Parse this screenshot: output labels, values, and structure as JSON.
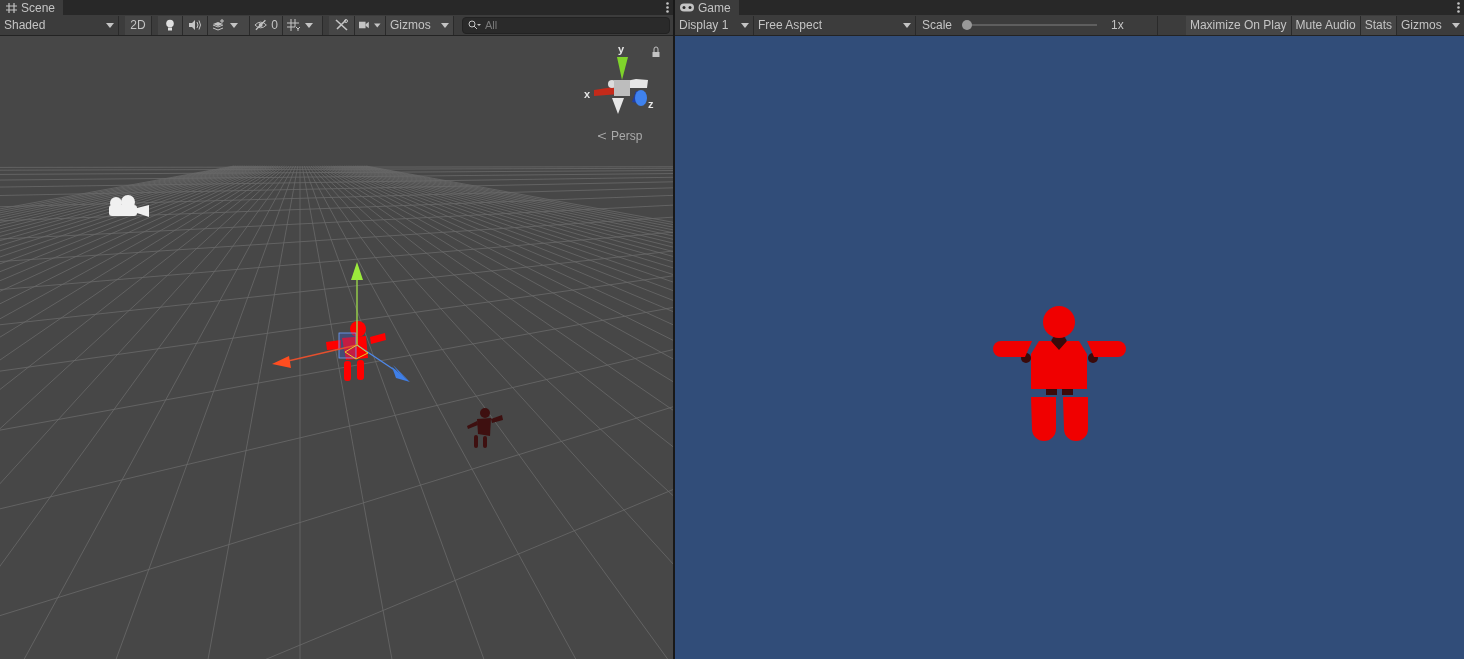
{
  "scene": {
    "tab": {
      "label": "Scene"
    },
    "toolbar": {
      "draw_mode": "Shaded",
      "mode_2d": "2D",
      "hidden_count": "0",
      "gizmos": "Gizmos",
      "search": {
        "placeholder": "All"
      }
    },
    "view": {
      "axis_labels": [
        "x",
        "y",
        "z"
      ],
      "projection": "Persp"
    }
  },
  "game": {
    "tab": {
      "label": "Game"
    },
    "toolbar": {
      "display": "Display 1",
      "aspect": "Free Aspect",
      "scale": {
        "label": "Scale",
        "level": 0,
        "reading": "1x"
      },
      "buttons": [
        "Maximize On Play",
        "Mute Audio",
        "Stats"
      ],
      "gizmos": "Gizmos"
    }
  }
}
